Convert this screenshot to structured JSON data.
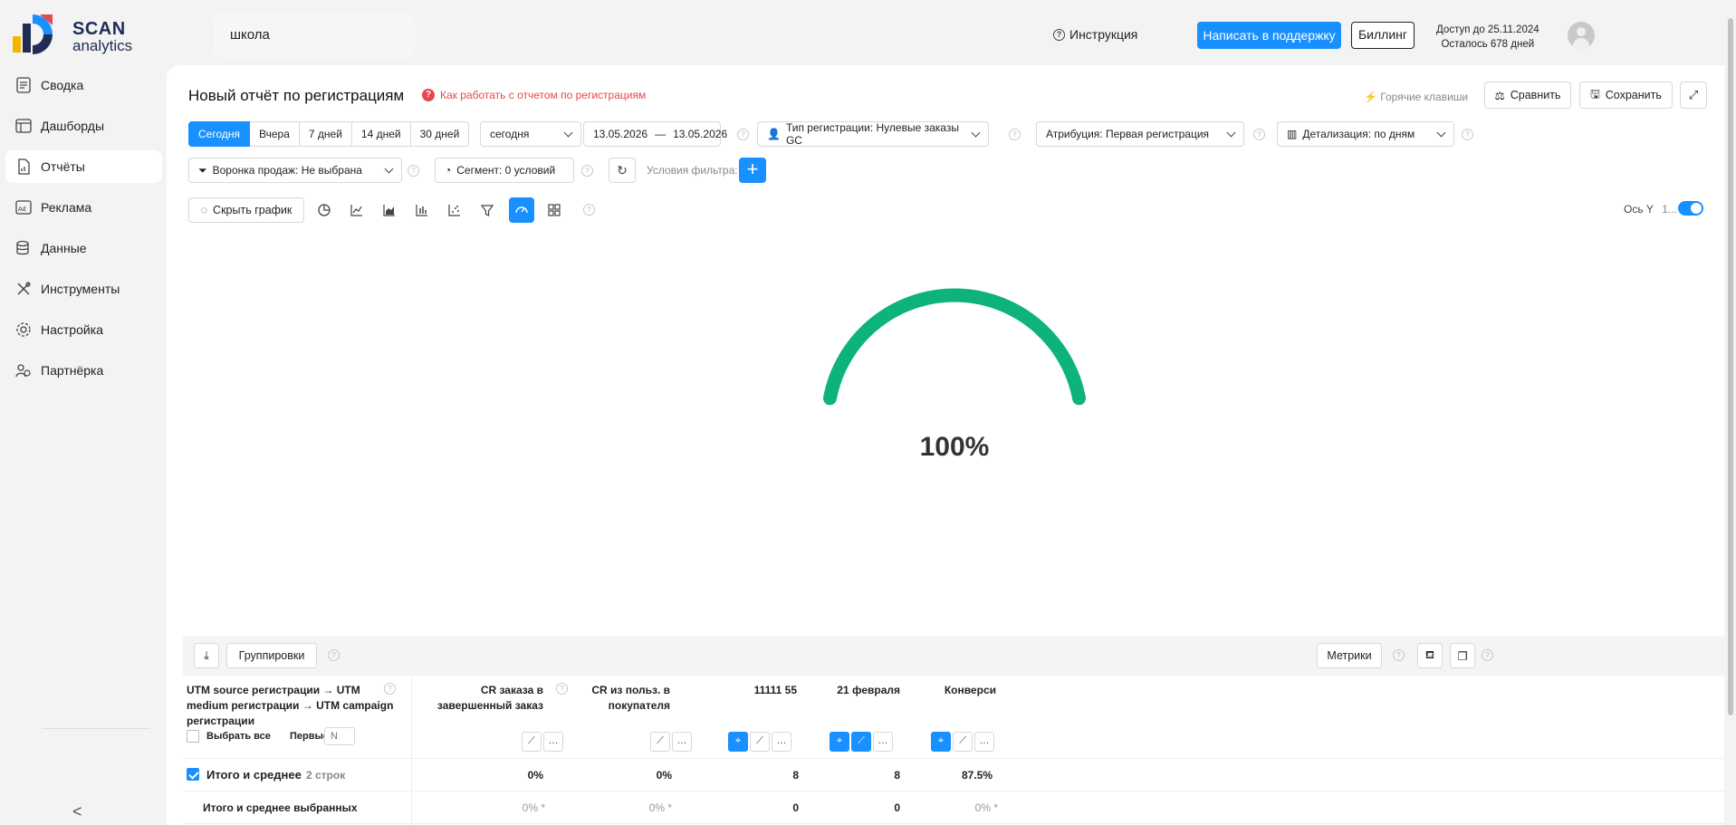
{
  "header": {
    "logo_line1": "SCAN",
    "logo_line2": "analytics",
    "project": "школа",
    "instructions": "Инструкция",
    "support_button": "Написать в поддержку",
    "billing_button": "Биллинг",
    "access_until": "Доступ до 25.11.2024",
    "days_left": "Осталось 678 дней"
  },
  "sidebar": {
    "items": [
      {
        "label": "Сводка",
        "icon": "summary-icon"
      },
      {
        "label": "Дашборды",
        "icon": "dashboard-icon"
      },
      {
        "label": "Отчёты",
        "icon": "reports-icon",
        "active": true
      },
      {
        "label": "Реклама",
        "icon": "ads-icon"
      },
      {
        "label": "Данные",
        "icon": "database-icon"
      },
      {
        "label": "Инструменты",
        "icon": "tools-icon"
      },
      {
        "label": "Настройка",
        "icon": "settings-icon"
      },
      {
        "label": "Партнёрка",
        "icon": "partners-icon"
      }
    ],
    "collapse": "<"
  },
  "report": {
    "title": "Новый отчёт по регистрациям",
    "howto": "Как работать с отчетом по регистрациям",
    "hotkeys": "Горячие клавиши",
    "compare": "Сравнить",
    "save": "Сохранить"
  },
  "filters": {
    "periods": [
      "Сегодня",
      "Вчера",
      "7 дней",
      "14 дней",
      "30 дней"
    ],
    "period_select": "сегодня",
    "date_from": "13.05.2026",
    "date_sep": "—",
    "date_to": "13.05.2026",
    "reg_type": "Тип регистрации: Нулевые заказы GC",
    "attribution": "Атрибуция: Первая регистрация",
    "detail": "Детализация:  по дням",
    "funnel": "Воронка продаж: Не выбрана",
    "segment": "Сегмент: 0 условий",
    "conditions": "Условия фильтра:",
    "hide_chart": "Скрыть график",
    "axis_y": "Ось Y",
    "axis_sort": "1..."
  },
  "chart_data": {
    "type": "gauge",
    "value": 100,
    "max": 100,
    "label": "100%",
    "color": "#0db37a"
  },
  "table": {
    "groupings": "Группировки",
    "metrics": "Метрики",
    "dimension_header": "UTM source регистрации → UTM medium регистрации → UTM campaign регистрации",
    "select_all": "Выбрать все",
    "first": "Первые",
    "first_placeholder": "N",
    "columns": [
      {
        "title": "CR заказа в завершенный заказ"
      },
      {
        "title": "CR из польз. в покупателя"
      },
      {
        "title": "11111 55"
      },
      {
        "title": "21 февраля"
      },
      {
        "title": "Конверси"
      }
    ],
    "rows": [
      {
        "label": "Итого и среднее",
        "count": "2 строк",
        "values": [
          "0%",
          "0%",
          "8",
          "8",
          "87.5%"
        ]
      },
      {
        "label": "Итого и среднее выбранных",
        "values": [
          "0% *",
          "0% *",
          "0",
          "0",
          "0% *"
        ]
      }
    ]
  }
}
